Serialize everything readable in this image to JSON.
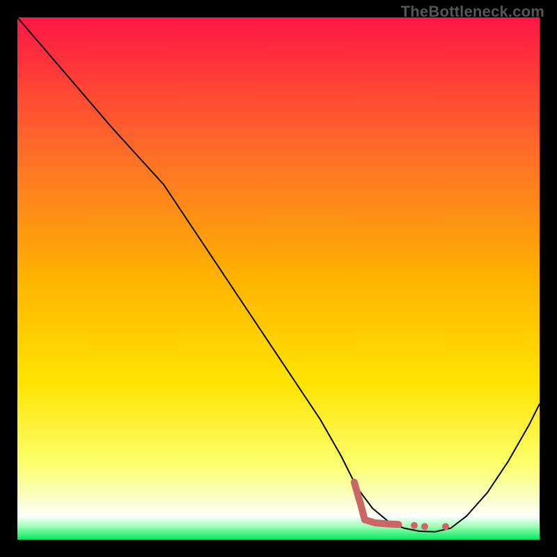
{
  "watermark": "TheBottleneck.com",
  "chart_data": {
    "type": "line",
    "title": "",
    "xlabel": "",
    "ylabel": "",
    "xlim": [
      0,
      100
    ],
    "ylim": [
      0,
      100
    ],
    "gradient_stops": [
      {
        "offset": 0.0,
        "color": "#ff1744"
      },
      {
        "offset": 0.25,
        "color": "#ff6a2a"
      },
      {
        "offset": 0.5,
        "color": "#ffb300"
      },
      {
        "offset": 0.7,
        "color": "#ffe400"
      },
      {
        "offset": 0.86,
        "color": "#fcff70"
      },
      {
        "offset": 0.92,
        "color": "#f9ffc4"
      },
      {
        "offset": 0.955,
        "color": "#ffffff"
      },
      {
        "offset": 0.975,
        "color": "#9cffb3"
      },
      {
        "offset": 1.0,
        "color": "#00e861"
      }
    ],
    "series": [
      {
        "name": "bottleneck-curve",
        "stroke": "#000000",
        "stroke_width": 2,
        "points": [
          {
            "x": 0,
            "y": 100
          },
          {
            "x": 6,
            "y": 93
          },
          {
            "x": 12,
            "y": 86
          },
          {
            "x": 18,
            "y": 79
          },
          {
            "x": 23,
            "y": 73.5
          },
          {
            "x": 28,
            "y": 68
          },
          {
            "x": 34,
            "y": 59
          },
          {
            "x": 40,
            "y": 50
          },
          {
            "x": 46,
            "y": 41
          },
          {
            "x": 52,
            "y": 32
          },
          {
            "x": 58,
            "y": 23
          },
          {
            "x": 62,
            "y": 16
          },
          {
            "x": 65,
            "y": 10
          },
          {
            "x": 68,
            "y": 6
          },
          {
            "x": 71,
            "y": 3.5
          },
          {
            "x": 74,
            "y": 2.2
          },
          {
            "x": 77,
            "y": 1.6
          },
          {
            "x": 80,
            "y": 1.5
          },
          {
            "x": 83,
            "y": 2.2
          },
          {
            "x": 86,
            "y": 4.5
          },
          {
            "x": 90,
            "y": 9
          },
          {
            "x": 94,
            "y": 15
          },
          {
            "x": 98,
            "y": 22
          },
          {
            "x": 100,
            "y": 26
          }
        ]
      },
      {
        "name": "highlight-segment",
        "stroke": "#cc6666",
        "stroke_width": 10,
        "points": [
          {
            "x": 64.5,
            "y": 11
          },
          {
            "x": 65.8,
            "y": 6.5
          },
          {
            "x": 66.5,
            "y": 3.8
          },
          {
            "x": 68.5,
            "y": 3.2
          },
          {
            "x": 71,
            "y": 3.0
          },
          {
            "x": 73,
            "y": 2.9
          }
        ]
      }
    ],
    "highlight_dots": {
      "stroke": "#cc6666",
      "r": 5,
      "points": [
        {
          "x": 76,
          "y": 2.7
        },
        {
          "x": 78,
          "y": 2.5
        },
        {
          "x": 82,
          "y": 2.5
        }
      ]
    }
  }
}
